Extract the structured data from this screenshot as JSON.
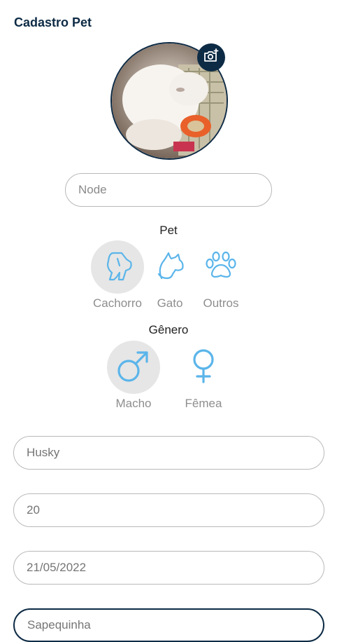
{
  "header": {
    "title": "Cadastro Pet"
  },
  "photo": {
    "camera_icon": "camera-add-icon"
  },
  "name_field": {
    "value": "Node"
  },
  "pet_section": {
    "label": "Pet",
    "options": [
      {
        "label": "Cachorro",
        "icon": "dog-icon",
        "selected": true
      },
      {
        "label": "Gato",
        "icon": "cat-icon",
        "selected": false
      },
      {
        "label": "Outros",
        "icon": "paw-icon",
        "selected": false
      }
    ]
  },
  "gender_section": {
    "label": "Gênero",
    "options": [
      {
        "label": "Macho",
        "icon": "male-icon",
        "selected": true
      },
      {
        "label": "Fêmea",
        "icon": "female-icon",
        "selected": false
      }
    ]
  },
  "fields": {
    "breed": "Husky",
    "age": "20",
    "date": "21/05/2022",
    "nickname": "Sapequinha"
  },
  "colors": {
    "primary": "#0d2b45",
    "icon": "#5bb5ea",
    "selected_bg": "#e6e6e6",
    "border": "#b9b9b9"
  }
}
